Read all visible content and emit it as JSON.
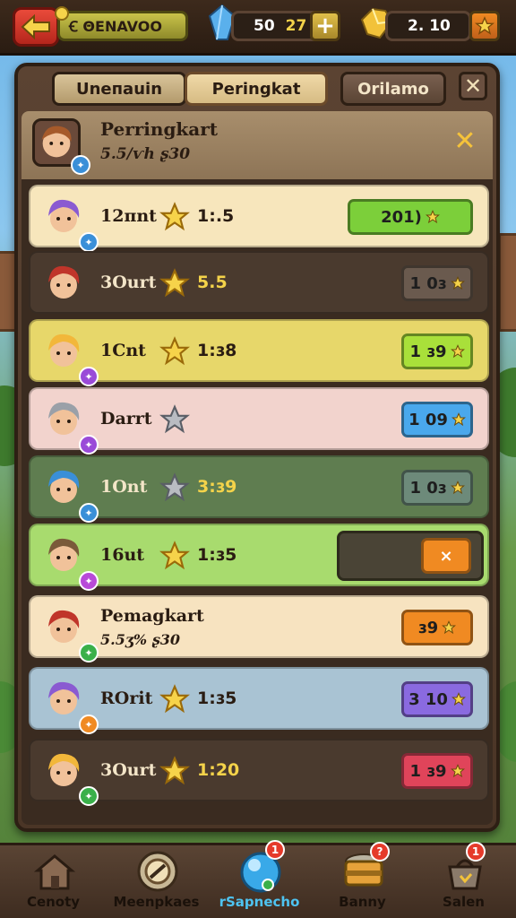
{
  "topbar": {
    "player_name": "Ꞓ ΘENAVOO",
    "gems": "50",
    "gems_bonus": "27",
    "crystals": "2. 10"
  },
  "tabs": [
    {
      "label": "Uneпauin"
    },
    {
      "label": "Peringkat"
    },
    {
      "label": "Orilamo"
    }
  ],
  "header": {
    "title": "Perringkart",
    "subtitle": "5.5/ѵh  ʂ30"
  },
  "rows": [
    {
      "name": "12пnt",
      "star": "gold",
      "score": "1:.5",
      "button": "201)",
      "button_icon": "star",
      "bg": "#f7e6bc",
      "btn_color": "#7ccf3a",
      "avatar_color": "#8a5ad1",
      "badge_color": "#3a8fd8"
    },
    {
      "name": "3Ourt",
      "star": "gold",
      "score": "5.5",
      "button": "1 0ɜ",
      "button_icon": "star",
      "bg": "#4a3a2e",
      "btn_color": "#6a5a4e",
      "avatar_color": "#c0352a",
      "badge_color": ""
    },
    {
      "name": "1Cnt",
      "star": "gold",
      "score": "1:ɜ8",
      "button": "1 ɜ9",
      "button_icon": "star",
      "bg": "#e7d76a",
      "btn_color": "#a9e03a",
      "avatar_color": "#f2b73a",
      "badge_color": "#9a4ad8"
    },
    {
      "name": "Darrt",
      "star": "gray",
      "score": "",
      "button": "1 09",
      "button_icon": "star",
      "bg": "#f2d3cd",
      "btn_color": "#4aa8ec",
      "avatar_color": "#9aa0a8",
      "badge_color": "#9a4ad8"
    },
    {
      "name": "1Ont",
      "star": "gray",
      "score": "3:ɜ9",
      "button": "1 0ɜ",
      "button_icon": "star",
      "bg": "#5f7d50",
      "btn_color": "#6d8a7a",
      "avatar_color": "#3a8fd8",
      "badge_color": "#3a8fd8"
    },
    {
      "name": "16ut",
      "star": "gold",
      "score": "1:ɜ5",
      "button": "×",
      "button_icon": "",
      "bg": "#a8db6e",
      "btn_color": "#f08a22",
      "avatar_color": "#7a5a3a",
      "badge_color": "#b84ad8"
    },
    {
      "name": "Pemagkart",
      "star": "",
      "score": "",
      "sub": "5.5ʒ%  ʂ30",
      "button": "ɜ9",
      "button_icon": "star",
      "bg": "#f7e3c0",
      "btn_color": "#f08a22",
      "avatar_color": "#c0352a",
      "badge_color": "#3ab04a"
    },
    {
      "name": "ROrit",
      "star": "gold",
      "score": "1:ɜ5",
      "button": "3 10",
      "button_icon": "star",
      "bg": "#a9c3d3",
      "btn_color": "#8a6ae0",
      "avatar_color": "#8a5ad1",
      "badge_color": "#f08a22"
    },
    {
      "name": "3Ourt",
      "star": "gold",
      "score": "1:20",
      "button": "1 ɜ9",
      "button_icon": "star",
      "bg": "#4a3a2e",
      "btn_color": "#e0445a",
      "avatar_color": "#f2b73a",
      "badge_color": "#3ab04a"
    }
  ],
  "bottom_nav": [
    {
      "label": "Cenoty",
      "icon": "house-icon",
      "badge": ""
    },
    {
      "label": "Meenpkaes",
      "icon": "shield-icon",
      "badge": ""
    },
    {
      "label": "rSapnecho",
      "icon": "orb-icon",
      "badge": "1"
    },
    {
      "label": "Banny",
      "icon": "chest-icon",
      "badge": "?"
    },
    {
      "label": "Salen",
      "icon": "bag-icon",
      "badge": "1"
    }
  ]
}
